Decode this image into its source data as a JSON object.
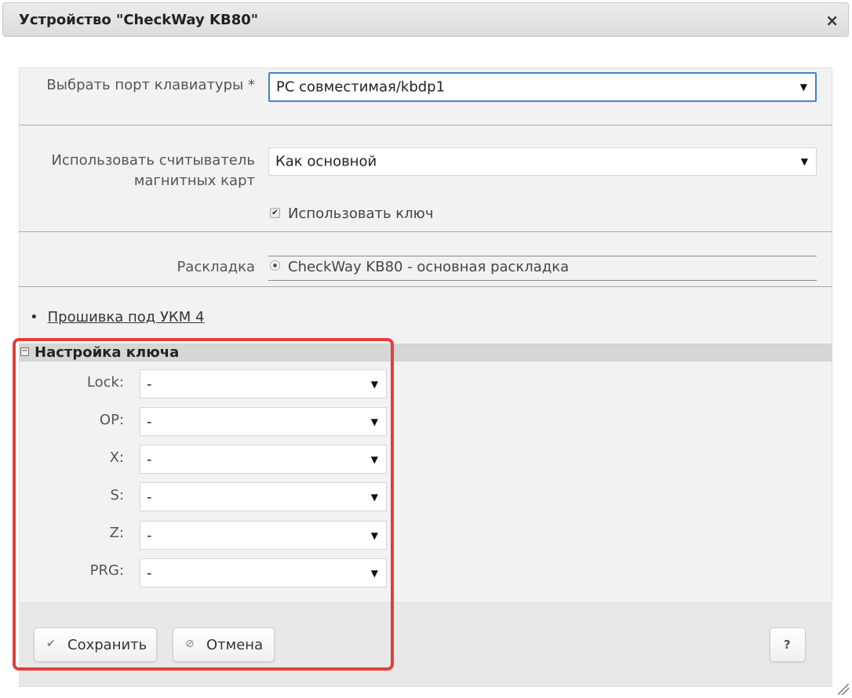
{
  "dialog": {
    "title": "Устройство \"CheckWay KB80\"",
    "close_symbol": "×"
  },
  "form": {
    "keyboard_port": {
      "label": "Выбрать порт клавиатуры *",
      "value": "PC совместимая/kbdp1"
    },
    "card_reader": {
      "label": "Использовать считыватель магнитных карт",
      "value": "Как основной"
    },
    "use_key": {
      "label": "Использовать ключ",
      "checked": true
    },
    "layout": {
      "label": "Раскладка",
      "option": "CheckWay KB80 - основная раскладка",
      "selected": true
    },
    "firmware_link": "Прошивка под УКМ 4"
  },
  "key_settings": {
    "title": "Настройка ключа",
    "toggle_symbol": "⊟",
    "fields": [
      {
        "label": "Lock:",
        "value": "-"
      },
      {
        "label": "OP:",
        "value": "-"
      },
      {
        "label": "X:",
        "value": "-"
      },
      {
        "label": "S:",
        "value": "-"
      },
      {
        "label": "Z:",
        "value": "-"
      },
      {
        "label": "PRG:",
        "value": "-"
      }
    ]
  },
  "footer": {
    "save_label": "Сохранить",
    "cancel_label": "Отмена",
    "help_label": "?"
  },
  "icons": {
    "close": "close-icon",
    "dropdown": "chevron-down-icon",
    "checkbox": "check-icon",
    "collapse": "collapse-icon",
    "save": "check-icon",
    "cancel": "cancel-icon",
    "resize": "resize-handle-icon"
  },
  "colors": {
    "highlight_border": "#e0403a",
    "focus_border": "#4a7fc6",
    "section_bar": "#d6d6d6"
  }
}
